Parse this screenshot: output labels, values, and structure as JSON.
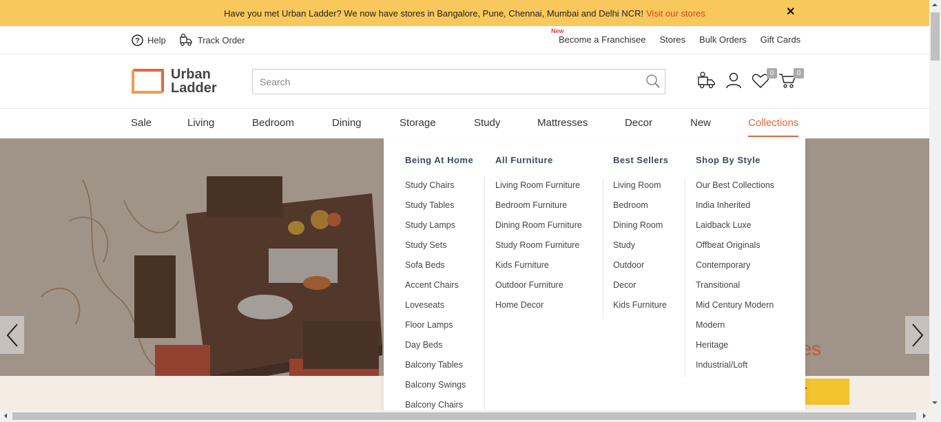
{
  "announcement": {
    "text": "Have you met Urban Ladder? We now have stores in Bangalore, Pune, Chennai, Mumbai and Delhi NCR!",
    "link": "Visit our stores",
    "close": "✕"
  },
  "utility": {
    "help": "Help",
    "track_order": "Track Order",
    "new_tag": "New",
    "franchisee": "Become a Franchisee",
    "stores": "Stores",
    "bulk_orders": "Bulk Orders",
    "gift_cards": "Gift Cards"
  },
  "logo": {
    "line1": "Urban",
    "line2": "Ladder"
  },
  "search": {
    "placeholder": "Search"
  },
  "header_icons": {
    "wishlist_count": "0",
    "cart_count": "0"
  },
  "nav": {
    "items": [
      "Sale",
      "Living",
      "Bedroom",
      "Dining",
      "Storage",
      "Study",
      "Mattresses",
      "Decor",
      "New",
      "Collections"
    ],
    "active": "Collections"
  },
  "dropdown": {
    "columns": [
      {
        "heading": "Being At Home",
        "links": [
          "Study Chairs",
          "Study Tables",
          "Study Lamps",
          "Study Sets",
          "Sofa Beds",
          "Accent Chairs",
          "Loveseats",
          "Floor Lamps",
          "Day Beds",
          "Balcony Tables",
          "Balcony Swings",
          "Balcony Chairs"
        ]
      },
      {
        "heading": "All Furniture",
        "links": [
          "Living Room Furniture",
          "Bedroom Furniture",
          "Dining Room Furniture",
          "Study Room Furniture",
          "Kids Furniture",
          "Outdoor Furniture",
          "Home Decor"
        ]
      },
      {
        "heading": "Best Sellers",
        "links": [
          "Living Room",
          "Bedroom",
          "Dining Room",
          "Study",
          "Outdoor",
          "Decor",
          "Kids Furniture"
        ]
      },
      {
        "heading": "Shop By Style",
        "links": [
          "Our Best Collections",
          "India Inherited",
          "Laidback Luxe",
          "Offbeat Originals",
          "Contemporary",
          "Transitional",
          "Mid Century Modern",
          "Modern",
          "Heritage",
          "Industrial/Loft"
        ]
      }
    ]
  },
  "hero": {
    "text": "nces",
    "cta": "ET"
  },
  "colors": {
    "accent": "#e5673a",
    "announce_bg": "#f8c85c",
    "link_red": "#d6451a",
    "cta_yellow": "#f1c32d"
  }
}
